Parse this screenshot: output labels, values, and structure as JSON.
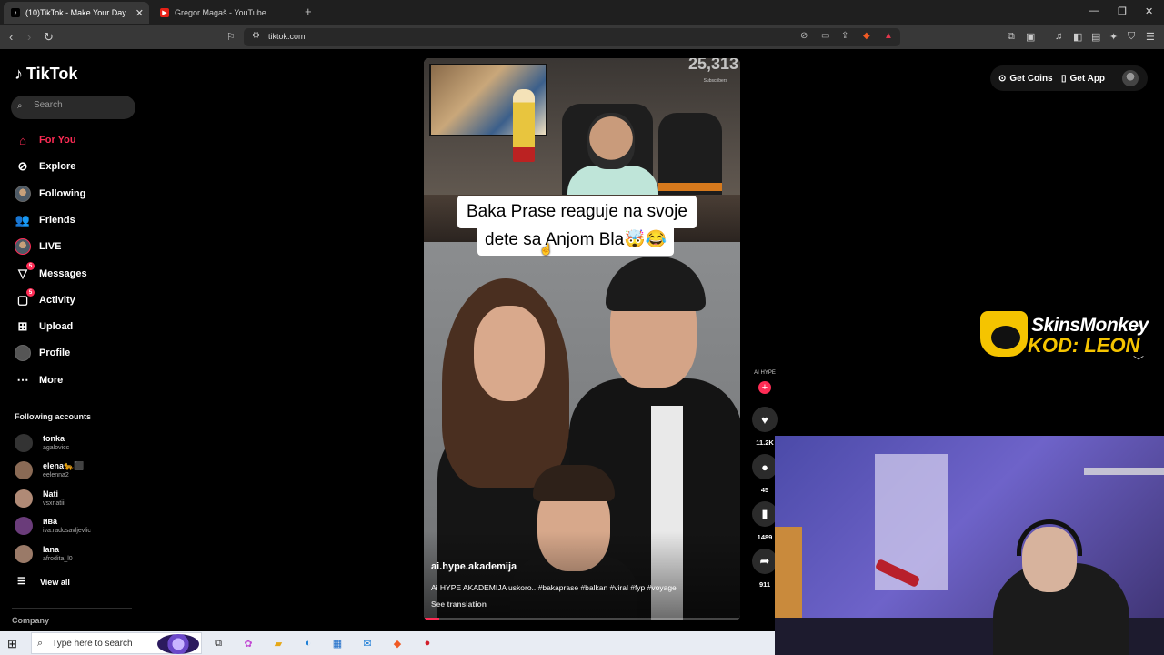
{
  "browser": {
    "tabs": [
      {
        "title": "(10)TikTok - Make Your Day",
        "active": true
      },
      {
        "title": "Gregor Magaš - YouTube",
        "active": false
      }
    ],
    "url": "tiktok.com"
  },
  "sidebar": {
    "brand": "TikTok",
    "search_placeholder": "Search",
    "nav": [
      {
        "label": "For You",
        "icon": "home-icon",
        "active": true
      },
      {
        "label": "Explore",
        "icon": "compass-icon"
      },
      {
        "label": "Following",
        "icon": "following-avatar-icon"
      },
      {
        "label": "Friends",
        "icon": "friends-icon"
      },
      {
        "label": "LIVE",
        "icon": "live-icon"
      },
      {
        "label": "Messages",
        "icon": "messages-icon",
        "badge": "5"
      },
      {
        "label": "Activity",
        "icon": "activity-icon",
        "badge": "5"
      },
      {
        "label": "Upload",
        "icon": "upload-icon"
      },
      {
        "label": "Profile",
        "icon": "profile-icon"
      },
      {
        "label": "More",
        "icon": "more-icon"
      }
    ],
    "following_header": "Following accounts",
    "accounts": [
      {
        "name": "tonka",
        "handle": "agalovicc"
      },
      {
        "name": "elena🐆⬛",
        "handle": "eelenna2"
      },
      {
        "name": "Nati",
        "handle": "vsxnatiii"
      },
      {
        "name": "ива",
        "handle": "iva.radosavljevlic"
      },
      {
        "name": "lana",
        "handle": "afrodita_l0"
      }
    ],
    "view_all": "View all",
    "company": "Company"
  },
  "header_actions": {
    "get_coins": "Get Coins",
    "get_app": "Get App"
  },
  "video": {
    "overlay_count": "25,313",
    "overlay_count_label": "Subscribers",
    "caption_line1": "Baka Prase reaguje na svoje",
    "caption_line2": "dete sa Anjom Bla🤯😂",
    "author": "ai.hype.akademija",
    "description": "Ai HYPE AKADEMIJA uskoro...#bakaprase #balkan #viral #fyp #voyage",
    "see_translation": "See translation",
    "progress": 0.05
  },
  "actions": {
    "creator_badge": "AI HYPE",
    "likes": "11.2K",
    "comments": "45",
    "saves": "1489",
    "shares": "911"
  },
  "sponsor": {
    "brand": "SkinsMonkey",
    "code": "KOD: LEON"
  },
  "taskbar": {
    "search_placeholder": "Type here to search"
  },
  "colors": {
    "accent": "#fe2c55",
    "sponsor_yellow": "#f5c400"
  }
}
